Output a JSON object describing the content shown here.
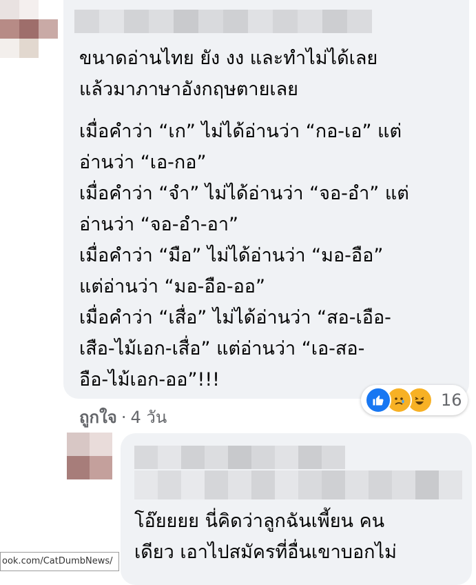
{
  "comment": {
    "paragraph1": "ขนาดอ่านไทย ยัง งง และทำไม่ได้เลย\nแล้วมาภาษาอังกฤษตายเลย",
    "paragraph2": "เมื่อคำว่า “เก” ไม่ได้อ่านว่า “กอ-เอ” แต่\nอ่านว่า “เอ-กอ”\nเมื่อคำว่า “จำ” ไม่ได้อ่านว่า “จอ-อำ” แต่\nอ่านว่า “จอ-อำ-อา”\nเมื่อคำว่า “มือ” ไม่ได้อ่านว่า “มอ-อือ”\nแต่อ่านว่า “มอ-อือ-ออ”\nเมื่อคำว่า “เสื่อ” ไม่ได้อ่านว่า “สอ-เอือ-\nเสือ-ไม้เอก-เสื่อ” แต่อ่านว่า “เอ-สอ-\nอือ-ไม้เอก-ออ”!!!",
    "reactions": {
      "icons": [
        "like-icon",
        "sad-icon",
        "haha-icon"
      ],
      "count": "16"
    },
    "meta": {
      "like_label": "ถูกใจ",
      "separator": "·",
      "time": "4 วัน"
    }
  },
  "reply": {
    "text": "โอ๊ยยยย นี่คิดว่าลูกฉันเพี้ยน คน\nเดียว เอาไปสมัครที่อื่นเขาบอกไม่"
  },
  "watermark": "ook.com/CatDumbNews/",
  "colors": {
    "bubble": "#f0f2f5",
    "meta_text": "#65676b",
    "like_blue": "#1877f2",
    "emoji_yellow": "#f7b125"
  }
}
